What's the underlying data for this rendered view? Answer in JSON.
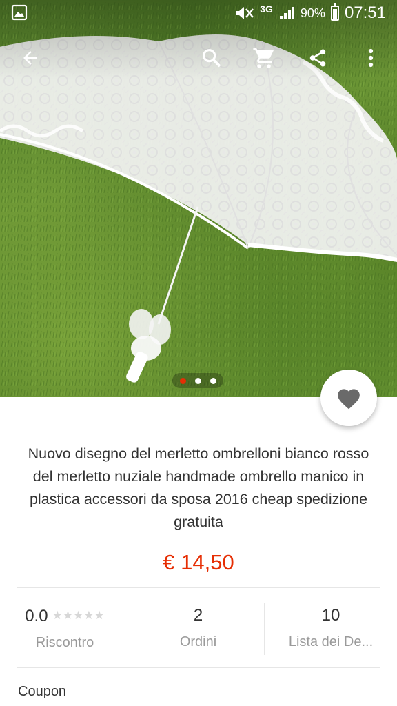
{
  "status_bar": {
    "network": "3G",
    "battery_percent": "90%",
    "time": "07:51"
  },
  "toolbar": {
    "icons": [
      "arrow-back-icon",
      "search-icon",
      "cart-icon",
      "share-icon",
      "more-vert-icon"
    ]
  },
  "carousel": {
    "page_count": 3,
    "active_index": 0,
    "active_color": "#e62e04"
  },
  "product": {
    "title": "Nuovo disegno del merletto ombrelloni bianco rosso del merletto nuziale handmade ombrello manico in plastica accessori da sposa 2016 cheap spedizione gratuita",
    "price": "€ 14,50",
    "price_color": "#e62e04"
  },
  "stats": {
    "rating": {
      "value": "0.0",
      "stars": "★★★★★",
      "stars_filled": 0,
      "label": "Riscontro"
    },
    "orders": {
      "value": "2",
      "label": "Ordini"
    },
    "wishlist": {
      "value": "10",
      "label": "Lista dei De..."
    }
  },
  "coupon": {
    "label": "Coupon"
  }
}
